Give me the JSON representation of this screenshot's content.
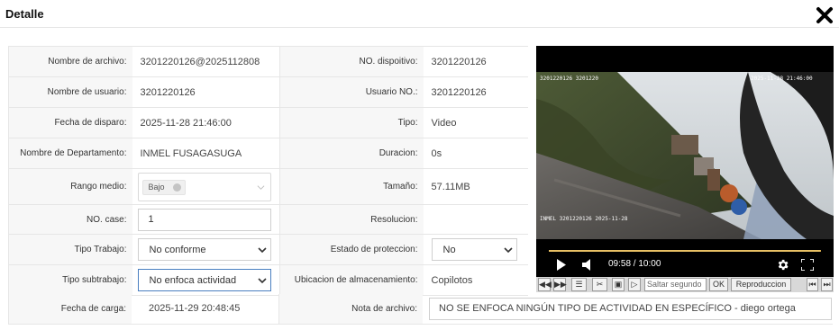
{
  "dialog": {
    "title": "Detalle"
  },
  "fields": {
    "file_name": {
      "label": "Nombre de archivo:",
      "value": "3201220126@2025112808"
    },
    "device_no": {
      "label": "NO. dispoitivo:",
      "value": "3201220126"
    },
    "user_name": {
      "label": "Nombre de usuario:",
      "value": "3201220126"
    },
    "user_no": {
      "label": "Usuario NO.:",
      "value": "3201220126"
    },
    "trigger_date": {
      "label": "Fecha de disparo:",
      "value": "2025-11-28 21:46:00"
    },
    "type": {
      "label": "Tipo:",
      "value": "Video"
    },
    "department": {
      "label": "Nombre de Departamento:",
      "value": "INMEL FUSAGASUGA"
    },
    "duration": {
      "label": "Duracion:",
      "value": "0s"
    },
    "range": {
      "label": "Rango medio:",
      "tag": "Bajo"
    },
    "size": {
      "label": "Tamaño:",
      "value": "57.11MB"
    },
    "case_no": {
      "label": "NO. case:",
      "value": "1"
    },
    "resolution": {
      "label": "Resolucion:",
      "value": ""
    },
    "work_type": {
      "label": "Tipo Trabajo:",
      "value": "No conforme"
    },
    "protection": {
      "label": "Estado de proteccion:",
      "value": "No"
    },
    "sub_work_type": {
      "label": "Tipo subtrabajo:",
      "value": "No enfoca actividad"
    },
    "storage": {
      "label": "Ubicacion de almacenamiento:",
      "value": "Copilotos"
    },
    "upload_date": {
      "label": "Fecha de carga:",
      "value": "2025-11-29 20:48:45"
    },
    "note": {
      "label": "Nota de archivo:",
      "value": "NO SE ENFOCA NINGÚN TIPO DE ACTIVIDAD EN ESPECÍFICO - diego ortega"
    }
  },
  "player": {
    "time_display": "09:58 / 10:00",
    "progress": 0.997,
    "osd_top_left": "3201220126 3201220",
    "osd_top_right": "2025-11-28 21:46:00",
    "osd_bottom_left": "INMEL 3201220126 2025-11-28"
  },
  "toolbar": {
    "skip_placeholder": "Saltar segundo",
    "ok_label": "OK",
    "playback_label": "Reproduccion"
  },
  "icons": {
    "close": "close-x-icon",
    "play": "play-icon",
    "volume": "volume-icon",
    "settings": "gear-icon",
    "fullscreen": "fullscreen-icon"
  },
  "colors": {
    "focus_border": "#4a7fc0",
    "progress": "#d6a94a",
    "label_bg": "#f7f7f7"
  }
}
